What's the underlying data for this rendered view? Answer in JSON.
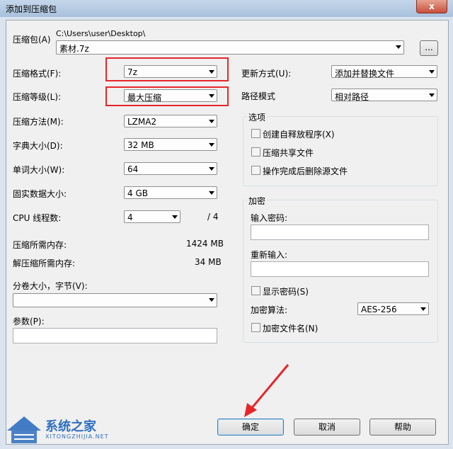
{
  "window": {
    "title": "添加到压缩包",
    "close_label": "x"
  },
  "archive": {
    "label": "压缩包(A)",
    "path": "C:\\Users\\user\\Desktop\\",
    "name": "素材.7z",
    "browse_label": "..."
  },
  "left": {
    "format": {
      "label": "压缩格式(F):",
      "value": "7z"
    },
    "level": {
      "label": "压缩等级(L):",
      "value": "最大压缩"
    },
    "method": {
      "label": "压缩方法(M):",
      "value": "LZMA2"
    },
    "dict": {
      "label": "字典大小(D):",
      "value": "32 MB"
    },
    "word": {
      "label": "单词大小(W):",
      "value": "64"
    },
    "solid": {
      "label": "固实数据大小:",
      "value": "4 GB"
    },
    "threads": {
      "label": "CPU 线程数:",
      "value": "4",
      "max": "/ 4"
    },
    "mem_compress": {
      "label": "压缩所需内存:",
      "value": "1424 MB"
    },
    "mem_decompress": {
      "label": "解压缩所需内存:",
      "value": "34 MB"
    },
    "volume": {
      "label": "分卷大小，字节(V):",
      "value": ""
    },
    "params": {
      "label": "参数(P):",
      "value": ""
    }
  },
  "right": {
    "update": {
      "label": "更新方式(U):",
      "value": "添加并替换文件"
    },
    "pathmode": {
      "label": "路径模式",
      "value": "相对路径"
    },
    "options": {
      "title": "选项",
      "sfx": "创建自释放程序(X)",
      "shared": "压缩共享文件",
      "delete": "操作完成后删除源文件"
    },
    "encryption": {
      "title": "加密",
      "password_label": "输入密码:",
      "reenter_label": "重新输入:",
      "show_password": "显示密码(S)",
      "method_label": "加密算法:",
      "method_value": "AES-256",
      "encrypt_names": "加密文件名(N)"
    }
  },
  "buttons": {
    "ok": "确定",
    "cancel": "取消",
    "help": "帮助"
  },
  "watermark": {
    "text": "系统之家",
    "sub": "XITONGZHIJIA.NET"
  },
  "colors": {
    "highlight": "#e6262a",
    "watermark_blue": "#2f6fc0"
  }
}
